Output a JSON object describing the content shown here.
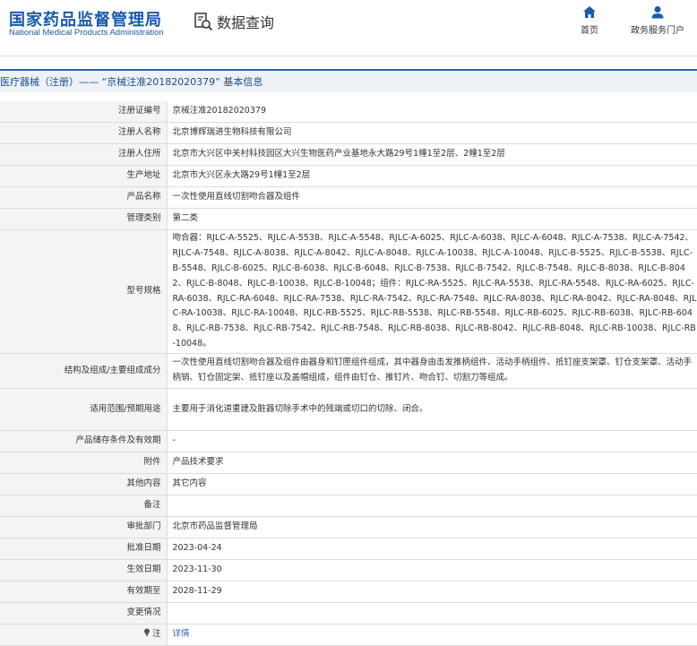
{
  "header": {
    "logo_cn": "国家药品监督管理局",
    "logo_en": "National Medical Products Administration",
    "query_title": "数据查询",
    "nav": [
      {
        "label": "首页",
        "icon": "home-icon"
      },
      {
        "label": "政务服务门户",
        "icon": "user-icon"
      }
    ]
  },
  "breadcrumb": "医疗器械（注册）—— “京械注准20182020379” 基本信息",
  "colors": {
    "brand": "#1a5aa6",
    "accent": "#2a63a8",
    "label_bg": "#f4f4f4"
  },
  "rows": [
    {
      "label": "注册证编号",
      "value": "京械注准20182020379"
    },
    {
      "label": "注册人名称",
      "value": "北京博辉瑞进生物科技有限公司"
    },
    {
      "label": "注册人住所",
      "value": "北京市大兴区中关村科技园区大兴生物医药产业基地永大路29号1幢1至2层、2幢1至2层"
    },
    {
      "label": "生产地址",
      "value": "北京市大兴区永大路29号1幢1至2层"
    },
    {
      "label": "产品名称",
      "value": "一次性使用直线切割吻合器及组件"
    },
    {
      "label": "管理类别",
      "value": "第二类"
    },
    {
      "label": "型号规格",
      "value": "吻合器：RJLC-A-5525、RJLC-A-5538、RJLC-A-5548、RJLC-A-6025、RJLC-A-6038、RJLC-A-6048、RJLC-A-7538、RJLC-A-7542、RJLC-A-7548、RJLC-A-8038、RJLC-A-8042、RJLC-A-8048、RJLC-A-10038、RJLC-A-10048、RJLC-B-5525、RJLC-B-5538、RJLC-B-5548、RJLC-B-6025、RJLC-B-6038、RJLC-B-6048、RJLC-B-7538、RJLC-B-7542、RJLC-B-7548、RJLC-B-8038、RJLC-B-8042、RJLC-B-8048、RJLC-B-10038、RJLC-B-10048；组件：RJLC-RA-5525、RJLC-RA-5538、RJLC-RA-5548、RJLC-RA-6025、RJLC-RA-6038、RJLC-RA-6048、RJLC-RA-7538、RJLC-RA-7542、RJLC-RA-7548、RJLC-RA-8038、RJLC-RA-8042、RJLC-RA-8048、RJLC-RA-10038、RJLC-RA-10048、RJLC-RB-5525、RJLC-RB-5538、RJLC-RB-5548、RJLC-RB-6025、RJLC-RB-6038、RJLC-RB-6048、RJLC-RB-7538、RJLC-RB-7542、RJLC-RB-7548、RJLC-RB-8038、RJLC-RB-8042、RJLC-RB-8048、RJLC-RB-10038、RJLC-RB-10048。"
    },
    {
      "label": "结构及组成/主要组成成分",
      "value": "一次性使用直线切割吻合器及组件由器身和钉匣组件组成，其中器身由击发推柄组件、活动手柄组件、抵钉座支架罩、钉仓支架罩、活动手柄销、钉仓固定架、抵钉座以及盖帽组成，组件由钉仓、推钉片、吻合钉、切割刀等组成。"
    },
    {
      "label": "适用范围/预期用途",
      "value": "主要用于消化道重建及脏器切除手术中的残端或切口的切除、闭合。"
    },
    {
      "label": "产品储存条件及有效期",
      "value": "-"
    },
    {
      "label": "附件",
      "value": "产品技术要求"
    },
    {
      "label": "其他内容",
      "value": "其它内容"
    },
    {
      "label": "备注",
      "value": ""
    },
    {
      "label": "审批部门",
      "value": "北京市药品监督管理局"
    },
    {
      "label": "批准日期",
      "value": "2023-04-24"
    },
    {
      "label": "生效日期",
      "value": "2023-11-30"
    },
    {
      "label": "有效期至",
      "value": "2028-11-29"
    },
    {
      "label": "变更情况",
      "value": ""
    },
    {
      "label": "注",
      "value": "详情",
      "icon": "pin-icon"
    }
  ]
}
